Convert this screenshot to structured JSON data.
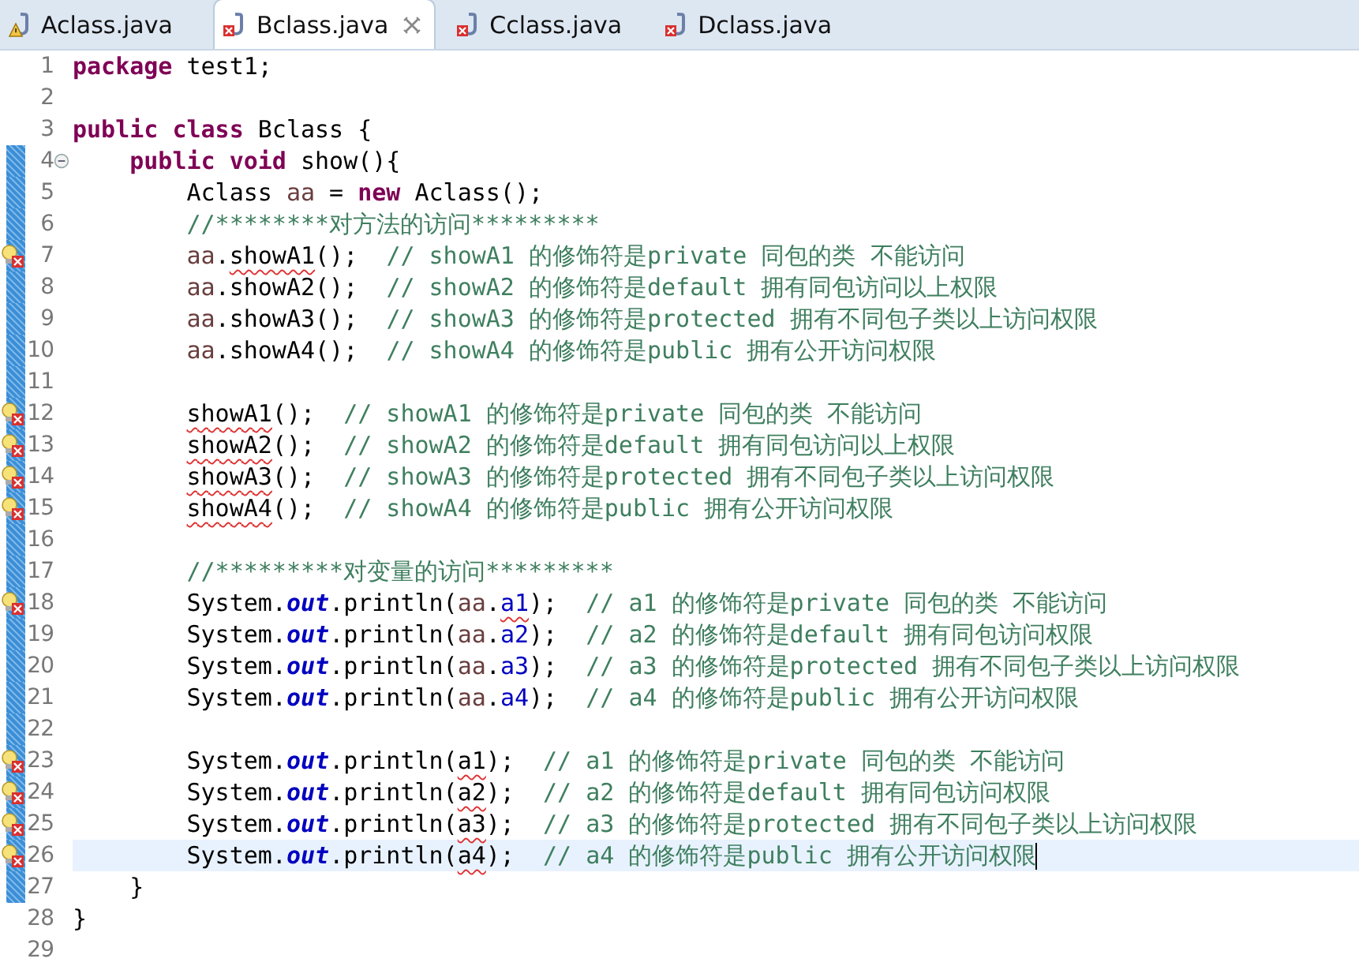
{
  "tabs": [
    {
      "label": "Aclass.java",
      "selected": false,
      "warning": true,
      "error": false
    },
    {
      "label": "Bclass.java",
      "selected": true,
      "warning": false,
      "error": true
    },
    {
      "label": "Cclass.java",
      "selected": false,
      "warning": false,
      "error": true
    },
    {
      "label": "Dclass.java",
      "selected": false,
      "warning": false,
      "error": true
    }
  ],
  "editor": {
    "lines": [
      {
        "number": "1",
        "changed": false,
        "current": false,
        "error": false,
        "foldable": false,
        "tokens": [
          {
            "kind": "keyword",
            "text": "package"
          },
          {
            "kind": "plain",
            "text": " test1;"
          }
        ]
      },
      {
        "number": "2",
        "changed": false,
        "current": false,
        "error": false,
        "foldable": false
      },
      {
        "number": "3",
        "changed": false,
        "current": false,
        "error": false,
        "foldable": false,
        "tokens": [
          {
            "kind": "keyword",
            "text": "public class"
          },
          {
            "kind": "plain",
            "text": " Bclass {"
          }
        ],
        "children": [
          {
            "number": "4",
            "changed": true,
            "current": false,
            "error": false,
            "foldable": true,
            "tokens": [
              {
                "kind": "keyword",
                "text": "public void"
              },
              {
                "kind": "plain",
                "text": " show(){"
              }
            ],
            "children": [
              {
                "number": "5",
                "changed": true,
                "current": false,
                "error": false,
                "foldable": false,
                "tokens": [
                  {
                    "kind": "plain",
                    "text": "Aclass "
                  },
                  {
                    "kind": "local",
                    "text": "aa"
                  },
                  {
                    "kind": "plain",
                    "text": " = "
                  },
                  {
                    "kind": "keyword",
                    "text": "new"
                  },
                  {
                    "kind": "plain",
                    "text": " Aclass();"
                  }
                ]
              },
              {
                "number": "6",
                "changed": true,
                "current": false,
                "error": false,
                "foldable": false,
                "tokens": [
                  {
                    "kind": "comment",
                    "text": "//********对方法的访问*********"
                  }
                ]
              },
              {
                "number": "7",
                "changed": true,
                "current": false,
                "error": true,
                "foldable": false,
                "tokens": [
                  {
                    "kind": "local",
                    "text": "aa"
                  },
                  {
                    "kind": "plain",
                    "text": "."
                  },
                  {
                    "kind": "plain",
                    "text": "showA1",
                    "squiggle": true
                  },
                  {
                    "kind": "plain",
                    "text": "();  "
                  },
                  {
                    "kind": "comment",
                    "text": "// showA1 的修饰符是private 同包的类 不能访问"
                  }
                ]
              },
              {
                "number": "8",
                "changed": true,
                "current": false,
                "error": false,
                "foldable": false,
                "tokens": [
                  {
                    "kind": "local",
                    "text": "aa"
                  },
                  {
                    "kind": "plain",
                    "text": ".showA2();  "
                  },
                  {
                    "kind": "comment",
                    "text": "// showA2 的修饰符是default 拥有同包访问以上权限"
                  }
                ]
              },
              {
                "number": "9",
                "changed": true,
                "current": false,
                "error": false,
                "foldable": false,
                "tokens": [
                  {
                    "kind": "local",
                    "text": "aa"
                  },
                  {
                    "kind": "plain",
                    "text": ".showA3();  "
                  },
                  {
                    "kind": "comment",
                    "text": "// showA3 的修饰符是protected 拥有不同包子类以上访问权限"
                  }
                ]
              },
              {
                "number": "10",
                "changed": true,
                "current": false,
                "error": false,
                "foldable": false,
                "tokens": [
                  {
                    "kind": "local",
                    "text": "aa"
                  },
                  {
                    "kind": "plain",
                    "text": ".showA4();  "
                  },
                  {
                    "kind": "comment",
                    "text": "// showA4 的修饰符是public 拥有公开访问权限"
                  }
                ]
              },
              {
                "number": "11",
                "changed": true,
                "current": false,
                "error": false,
                "foldable": false
              },
              {
                "number": "12",
                "changed": true,
                "current": false,
                "error": true,
                "foldable": false,
                "tokens": [
                  {
                    "kind": "plain",
                    "text": "showA1",
                    "squiggle": true
                  },
                  {
                    "kind": "plain",
                    "text": "();  "
                  },
                  {
                    "kind": "comment",
                    "text": "// showA1 的修饰符是private 同包的类 不能访问"
                  }
                ]
              },
              {
                "number": "13",
                "changed": true,
                "current": false,
                "error": true,
                "foldable": false,
                "tokens": [
                  {
                    "kind": "plain",
                    "text": "showA2",
                    "squiggle": true
                  },
                  {
                    "kind": "plain",
                    "text": "();  "
                  },
                  {
                    "kind": "comment",
                    "text": "// showA2 的修饰符是default 拥有同包访问以上权限"
                  }
                ]
              },
              {
                "number": "14",
                "changed": true,
                "current": false,
                "error": true,
                "foldable": false,
                "tokens": [
                  {
                    "kind": "plain",
                    "text": "showA3",
                    "squiggle": true
                  },
                  {
                    "kind": "plain",
                    "text": "();  "
                  },
                  {
                    "kind": "comment",
                    "text": "// showA3 的修饰符是protected 拥有不同包子类以上访问权限"
                  }
                ]
              },
              {
                "number": "15",
                "changed": true,
                "current": false,
                "error": true,
                "foldable": false,
                "tokens": [
                  {
                    "kind": "plain",
                    "text": "showA4",
                    "squiggle": true
                  },
                  {
                    "kind": "plain",
                    "text": "();  "
                  },
                  {
                    "kind": "comment",
                    "text": "// showA4 的修饰符是public 拥有公开访问权限"
                  }
                ]
              },
              {
                "number": "16",
                "changed": true,
                "current": false,
                "error": false,
                "foldable": false
              },
              {
                "number": "17",
                "changed": true,
                "current": false,
                "error": false,
                "foldable": false,
                "tokens": [
                  {
                    "kind": "comment",
                    "text": "//*********对变量的访问*********"
                  }
                ]
              },
              {
                "number": "18",
                "changed": true,
                "current": false,
                "error": true,
                "foldable": false,
                "tokens": [
                  {
                    "kind": "plain",
                    "text": "System."
                  },
                  {
                    "kind": "static",
                    "text": "out"
                  },
                  {
                    "kind": "plain",
                    "text": ".println("
                  },
                  {
                    "kind": "local",
                    "text": "aa"
                  },
                  {
                    "kind": "plain",
                    "text": "."
                  },
                  {
                    "kind": "field",
                    "text": "a1",
                    "squiggle": true
                  },
                  {
                    "kind": "plain",
                    "text": ");  "
                  },
                  {
                    "kind": "comment",
                    "text": "// a1 的修饰符是private 同包的类 不能访问"
                  }
                ]
              },
              {
                "number": "19",
                "changed": true,
                "current": false,
                "error": false,
                "foldable": false,
                "tokens": [
                  {
                    "kind": "plain",
                    "text": "System."
                  },
                  {
                    "kind": "static",
                    "text": "out"
                  },
                  {
                    "kind": "plain",
                    "text": ".println("
                  },
                  {
                    "kind": "local",
                    "text": "aa"
                  },
                  {
                    "kind": "plain",
                    "text": "."
                  },
                  {
                    "kind": "field",
                    "text": "a2"
                  },
                  {
                    "kind": "plain",
                    "text": ");  "
                  },
                  {
                    "kind": "comment",
                    "text": "// a2 的修饰符是default 拥有同包访问权限"
                  }
                ]
              },
              {
                "number": "20",
                "changed": true,
                "current": false,
                "error": false,
                "foldable": false,
                "tokens": [
                  {
                    "kind": "plain",
                    "text": "System."
                  },
                  {
                    "kind": "static",
                    "text": "out"
                  },
                  {
                    "kind": "plain",
                    "text": ".println("
                  },
                  {
                    "kind": "local",
                    "text": "aa"
                  },
                  {
                    "kind": "plain",
                    "text": "."
                  },
                  {
                    "kind": "field",
                    "text": "a3"
                  },
                  {
                    "kind": "plain",
                    "text": ");  "
                  },
                  {
                    "kind": "comment",
                    "text": "// a3 的修饰符是protected 拥有不同包子类以上访问权限"
                  }
                ]
              },
              {
                "number": "21",
                "changed": true,
                "current": false,
                "error": false,
                "foldable": false,
                "tokens": [
                  {
                    "kind": "plain",
                    "text": "System."
                  },
                  {
                    "kind": "static",
                    "text": "out"
                  },
                  {
                    "kind": "plain",
                    "text": ".println("
                  },
                  {
                    "kind": "local",
                    "text": "aa"
                  },
                  {
                    "kind": "plain",
                    "text": "."
                  },
                  {
                    "kind": "field",
                    "text": "a4"
                  },
                  {
                    "kind": "plain",
                    "text": ");  "
                  },
                  {
                    "kind": "comment",
                    "text": "// a4 的修饰符是public 拥有公开访问权限"
                  }
                ]
              },
              {
                "number": "22",
                "changed": true,
                "current": false,
                "error": false,
                "foldable": false
              },
              {
                "number": "23",
                "changed": true,
                "current": false,
                "error": true,
                "foldable": false,
                "tokens": [
                  {
                    "kind": "plain",
                    "text": "System."
                  },
                  {
                    "kind": "static",
                    "text": "out"
                  },
                  {
                    "kind": "plain",
                    "text": ".println("
                  },
                  {
                    "kind": "plain",
                    "text": "a1",
                    "squiggle": true
                  },
                  {
                    "kind": "plain",
                    "text": ");  "
                  },
                  {
                    "kind": "comment",
                    "text": "// a1 的修饰符是private 同包的类 不能访问"
                  }
                ]
              },
              {
                "number": "24",
                "changed": true,
                "current": false,
                "error": true,
                "foldable": false,
                "tokens": [
                  {
                    "kind": "plain",
                    "text": "System."
                  },
                  {
                    "kind": "static",
                    "text": "out"
                  },
                  {
                    "kind": "plain",
                    "text": ".println("
                  },
                  {
                    "kind": "plain",
                    "text": "a2",
                    "squiggle": true
                  },
                  {
                    "kind": "plain",
                    "text": ");  "
                  },
                  {
                    "kind": "comment",
                    "text": "// a2 的修饰符是default 拥有同包访问权限"
                  }
                ]
              },
              {
                "number": "25",
                "changed": true,
                "current": false,
                "error": true,
                "foldable": false,
                "tokens": [
                  {
                    "kind": "plain",
                    "text": "System."
                  },
                  {
                    "kind": "static",
                    "text": "out"
                  },
                  {
                    "kind": "plain",
                    "text": ".println("
                  },
                  {
                    "kind": "plain",
                    "text": "a3",
                    "squiggle": true
                  },
                  {
                    "kind": "plain",
                    "text": ");  "
                  },
                  {
                    "kind": "comment",
                    "text": "// a3 的修饰符是protected 拥有不同包子类以上访问权限"
                  }
                ]
              },
              {
                "number": "26",
                "changed": true,
                "current": true,
                "error": true,
                "foldable": false,
                "tokens": [
                  {
                    "kind": "plain",
                    "text": "System."
                  },
                  {
                    "kind": "static",
                    "text": "out"
                  },
                  {
                    "kind": "plain",
                    "text": ".println("
                  },
                  {
                    "kind": "plain",
                    "text": "a4",
                    "squiggle": true
                  },
                  {
                    "kind": "plain",
                    "text": ");  "
                  },
                  {
                    "kind": "comment",
                    "text": "// a4 的修饰符是public 拥有公开访问权限"
                  }
                ]
              }
            ]
          },
          {
            "number": "27",
            "changed": true,
            "current": false,
            "error": false,
            "foldable": false,
            "tokens": [
              {
                "kind": "plain",
                "text": "}"
              }
            ]
          }
        ]
      },
      {
        "number": "28",
        "changed": false,
        "current": false,
        "error": false,
        "foldable": false,
        "tokens": [
          {
            "kind": "plain",
            "text": "}"
          }
        ]
      },
      {
        "number": "29",
        "changed": false,
        "current": false,
        "error": false,
        "foldable": false
      }
    ]
  }
}
